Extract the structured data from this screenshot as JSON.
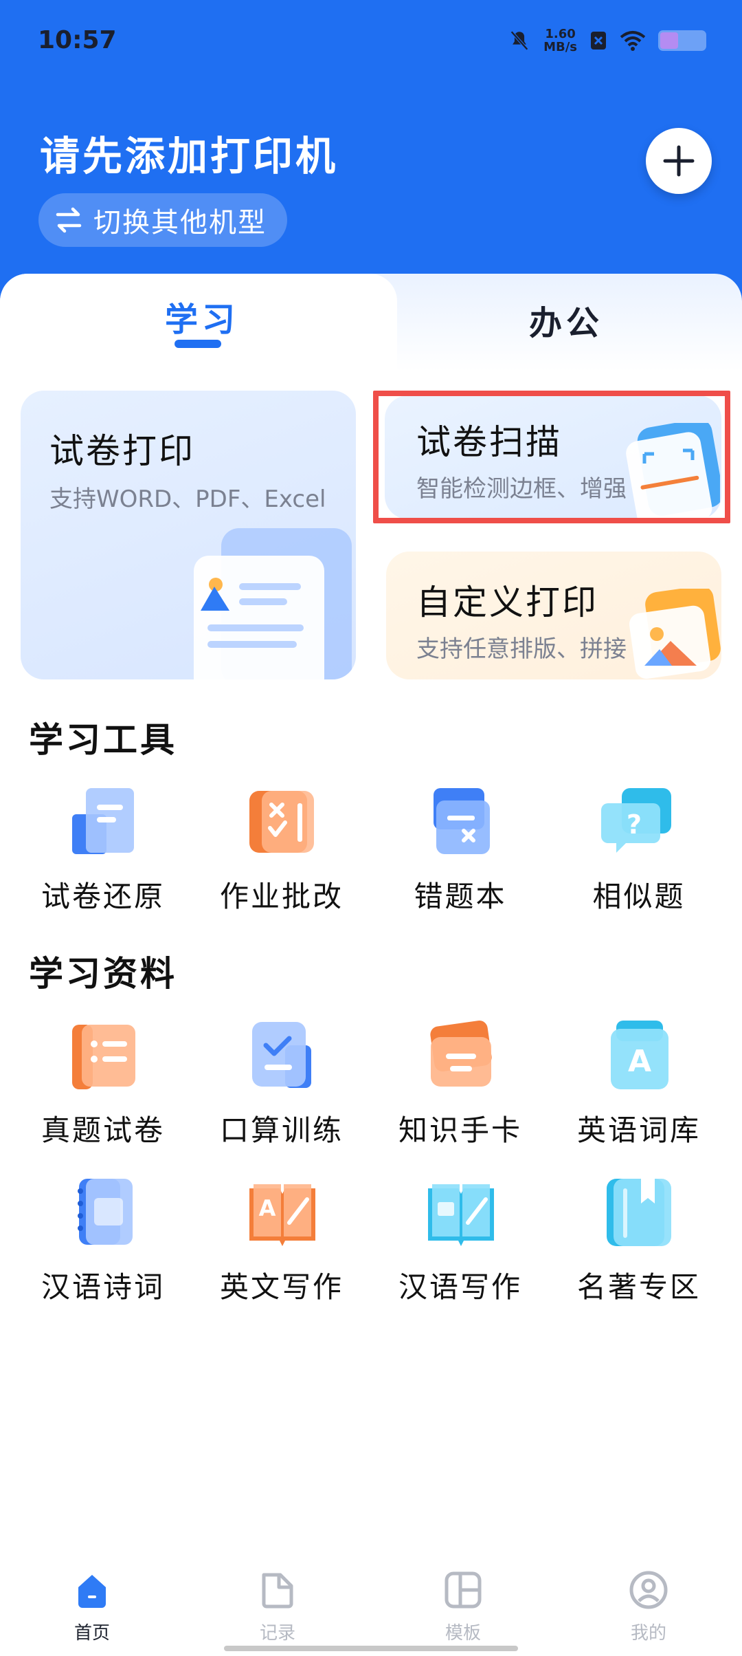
{
  "status_bar": {
    "time": "10:57",
    "net_speed_value": "1.60",
    "net_speed_unit": "MB/s"
  },
  "header": {
    "title": "请先添加打印机",
    "switch_label": "切换其他机型",
    "switch_icon": "swap-arrows-icon",
    "add_icon": "plus-icon"
  },
  "tabs": [
    {
      "label": "学习",
      "active": true
    },
    {
      "label": "办公",
      "active": false
    }
  ],
  "cards": {
    "exam_print": {
      "title": "试卷打印",
      "subtitle": "支持WORD、PDF、Excel"
    },
    "exam_scan": {
      "title": "试卷扫描",
      "subtitle": "智能检测边框、增强"
    },
    "custom_print": {
      "title": "自定义打印",
      "subtitle": "支持任意排版、拼接"
    }
  },
  "study_tools": {
    "title": "学习工具",
    "items": [
      {
        "label": "试卷还原",
        "icon": "exam-restore-icon"
      },
      {
        "label": "作业批改",
        "icon": "homework-correct-icon"
      },
      {
        "label": "错题本",
        "icon": "wrong-question-book-icon"
      },
      {
        "label": "相似题",
        "icon": "similar-question-icon"
      }
    ]
  },
  "study_materials": {
    "title": "学习资料",
    "items": [
      {
        "label": "真题试卷",
        "icon": "real-exam-icon"
      },
      {
        "label": "口算训练",
        "icon": "oral-calc-icon"
      },
      {
        "label": "知识手卡",
        "icon": "knowledge-card-icon"
      },
      {
        "label": "英语词库",
        "icon": "english-vocab-icon"
      },
      {
        "label": "汉语诗词",
        "icon": "chinese-poetry-icon"
      },
      {
        "label": "英文写作",
        "icon": "english-writing-icon"
      },
      {
        "label": "汉语写作",
        "icon": "chinese-writing-icon"
      },
      {
        "label": "名著专区",
        "icon": "classics-icon"
      }
    ]
  },
  "bottom_nav": [
    {
      "label": "首页",
      "icon": "home-icon",
      "active": true
    },
    {
      "label": "记录",
      "icon": "record-icon",
      "active": false
    },
    {
      "label": "模板",
      "icon": "template-icon",
      "active": false
    },
    {
      "label": "我的",
      "icon": "profile-icon",
      "active": false
    }
  ],
  "colors": {
    "brand_blue": "#1f6ff2",
    "highlight_red": "#ef4e49"
  }
}
